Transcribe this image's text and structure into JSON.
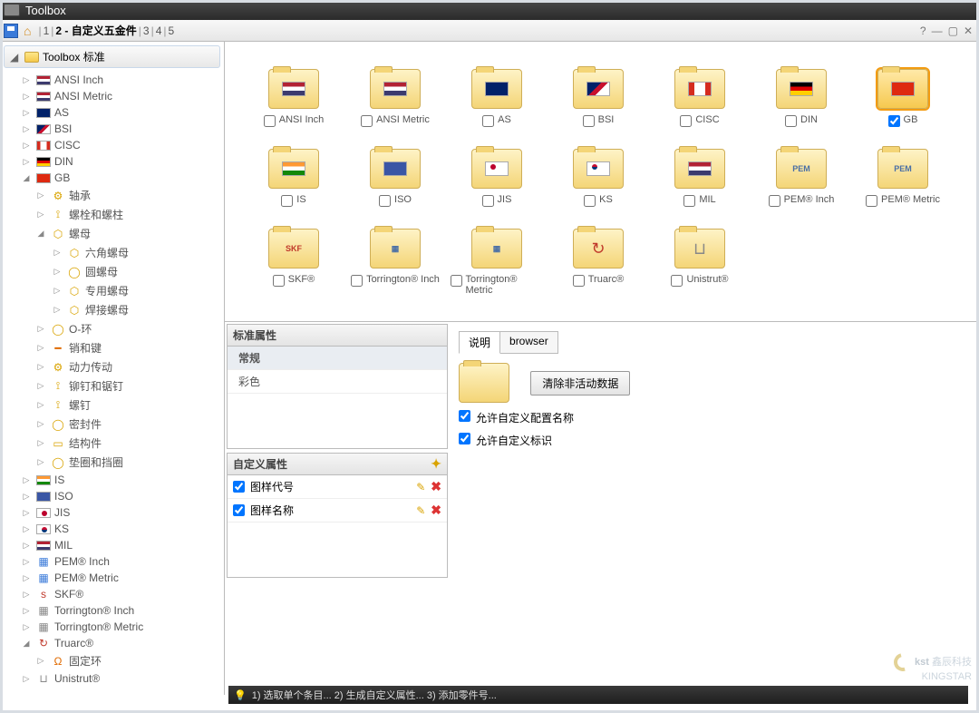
{
  "title": "Toolbox",
  "tabs": {
    "t1": "1",
    "t2": "2 - 自定义五金件",
    "t3": "3",
    "t4": "4",
    "t5": "5"
  },
  "tree": {
    "root": "Toolbox 标准",
    "ansi_inch": "ANSI Inch",
    "ansi_metric": "ANSI Metric",
    "as": "AS",
    "bsi": "BSI",
    "cisc": "CISC",
    "din": "DIN",
    "gb": "GB",
    "gb_bearing": "轴承",
    "gb_bolts": "螺栓和螺柱",
    "gb_nuts": "螺母",
    "gb_hexnut": "六角螺母",
    "gb_roundnut": "圆螺母",
    "gb_specialnut": "专用螺母",
    "gb_weldnut": "焊接螺母",
    "gb_oring": "O-环",
    "gb_pins": "销和键",
    "gb_power": "动力传动",
    "gb_rivets": "铆钉和锯钉",
    "gb_screws": "螺钉",
    "gb_seals": "密封件",
    "gb_struct": "结构件",
    "gb_washers": "垫圈和挡圈",
    "is": "IS",
    "iso": "ISO",
    "jis": "JIS",
    "ks": "KS",
    "mil": "MIL",
    "pem_inch": "PEM® Inch",
    "pem_metric": "PEM® Metric",
    "skf": "SKF®",
    "tor_inch": "Torrington® Inch",
    "tor_metric": "Torrington® Metric",
    "truarc": "Truarc®",
    "truarc_ring": "固定环",
    "unistrut": "Unistrut®"
  },
  "folders": {
    "ansi_inch": "ANSI Inch",
    "ansi_metric": "ANSI Metric",
    "as": "AS",
    "bsi": "BSI",
    "cisc": "CISC",
    "din": "DIN",
    "gb": "GB",
    "is": "IS",
    "iso": "ISO",
    "jis": "JIS",
    "ks": "KS",
    "mil": "MIL",
    "pem_inch": "PEM® Inch",
    "pem_metric": "PEM® Metric",
    "skf": "SKF®",
    "tor_inch": "Torrington® Inch",
    "tor_metric": "Torrington® Metric",
    "truarc": "Truarc®",
    "unistrut": "Unistrut®"
  },
  "panels": {
    "std_title": "标准属性",
    "std_general": "常规",
    "std_color": "彩色",
    "cust_title": "自定义属性",
    "cust_p1": "图样代号",
    "cust_p2": "图样名称"
  },
  "right": {
    "tab_desc": "说明",
    "tab_browser": "browser",
    "clear_btn": "清除非活动数据",
    "chk1": "允许自定义配置名称",
    "chk2": "允许自定义标识"
  },
  "status": "1) 选取单个条目... 2) 生成自定义属性... 3) 添加零件号...",
  "watermark": {
    "l1": "鑫辰科技",
    "l2": "KINGSTAR"
  }
}
